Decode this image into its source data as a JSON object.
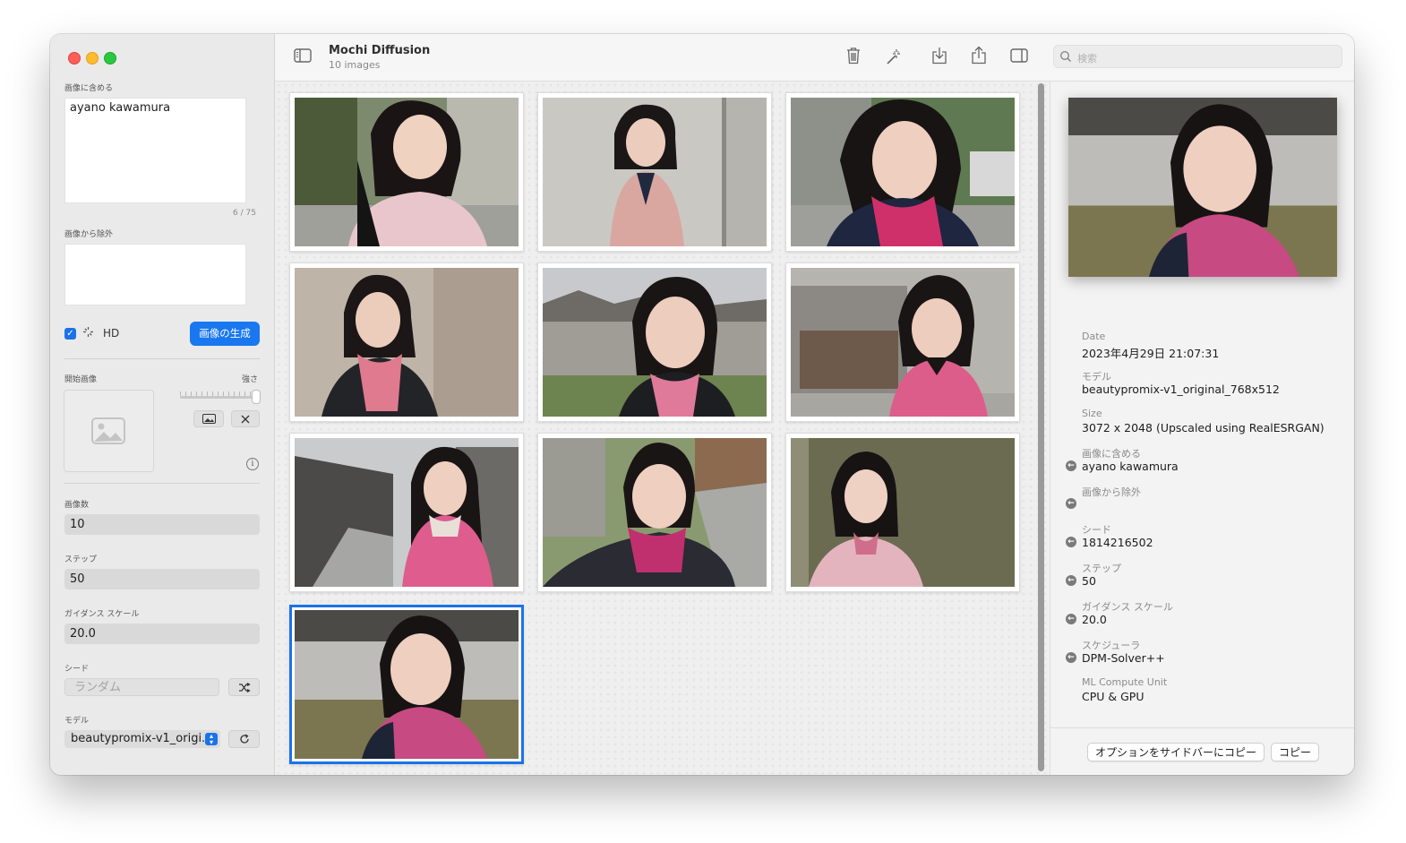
{
  "window": {
    "title": "Mochi Diffusion",
    "subtitle": "10 images"
  },
  "sidebar": {
    "include_label": "画像に含める",
    "include_value": "ayano kawamura",
    "include_counter": "6 / 75",
    "exclude_label": "画像から除外",
    "exclude_value": "",
    "hd_checked": true,
    "hd_label": "HD",
    "generate_button": "画像の生成",
    "start_image_label": "開始画像",
    "strength_label": "強さ",
    "count_label": "画像数",
    "count_value": "10",
    "steps_label": "ステップ",
    "steps_value": "50",
    "guidance_label": "ガイダンス スケール",
    "guidance_value": "20.0",
    "seed_label": "シード",
    "seed_placeholder": "ランダム",
    "model_label": "モデル",
    "model_value": "beautypromix-v1_origi..."
  },
  "toolbar": {
    "search_placeholder": "検索",
    "icons": [
      "sidebar-toggle-icon",
      "trash-icon",
      "magic-wand-icon",
      "download-icon",
      "share-icon",
      "inspector-toggle-icon",
      "search-icon"
    ]
  },
  "gallery": {
    "image_count": 10,
    "selected_index": 9
  },
  "inspector": {
    "date_label": "Date",
    "date_value": "2023年4月29日 21:07:31",
    "model_label": "モデル",
    "model_value": "beautypromix-v1_original_768x512",
    "size_label": "Size",
    "size_value": "3072 x 2048 (Upscaled using RealESRGAN)",
    "include_label": "画像に含める",
    "include_value": "ayano kawamura",
    "exclude_label": "画像から除外",
    "exclude_value": "",
    "seed_label": "シード",
    "seed_value": "1814216502",
    "steps_label": "ステップ",
    "steps_value": "50",
    "guidance_label": "ガイダンス スケール",
    "guidance_value": "20.0",
    "scheduler_label": "スケジューラ",
    "scheduler_value": "DPM-Solver++",
    "compute_label": "ML Compute Unit",
    "compute_value": "CPU & GPU",
    "copy_options_button": "オプションをサイドバーにコピー",
    "copy_button": "コピー"
  },
  "colors": {
    "accent": "#1a73e8",
    "traffic_red": "#fe5f57",
    "traffic_yellow": "#febc2e",
    "traffic_green": "#28c840"
  }
}
